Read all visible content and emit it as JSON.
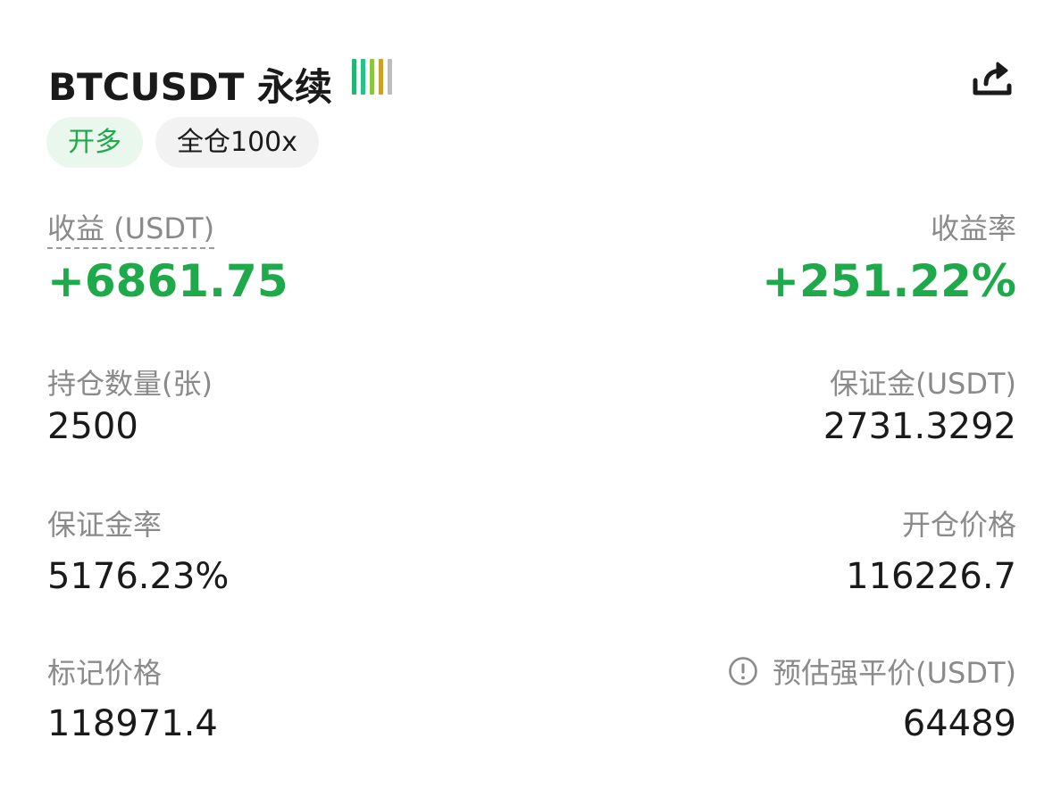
{
  "header": {
    "title": "BTCUSDT 永续",
    "liquidity_bar_colors": [
      "#22b573",
      "#27c28a",
      "#8cc63f",
      "#c9a227",
      "#bdbdbd"
    ],
    "share_icon": "share-icon"
  },
  "tags": {
    "side": "开多",
    "margin_mode": "全仓100x"
  },
  "colors": {
    "profit_green": "#1ea94a",
    "label_gray": "#8a8a8a",
    "text_dark": "#1a1a1a"
  },
  "stats": {
    "pnl_label": "收益 (USDT)",
    "pnl_value": "+6861.75",
    "roi_label": "收益率",
    "roi_value": "+251.22%",
    "position_label": "持仓数量(张)",
    "position_value": "2500",
    "margin_label": "保证金(USDT)",
    "margin_value": "2731.3292",
    "margin_ratio_label": "保证金率",
    "margin_ratio_value": "5176.23%",
    "entry_price_label": "开仓价格",
    "entry_price_value": "116226.7",
    "mark_price_label": "标记价格",
    "mark_price_value": "118971.4",
    "liq_price_label": "预估强平价(USDT)",
    "liq_price_value": "64489",
    "liq_info_icon": "info-icon"
  }
}
